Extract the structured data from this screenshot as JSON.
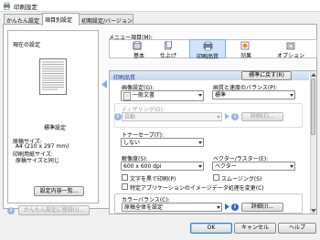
{
  "window": {
    "title": "印刷設定"
  },
  "tabs": [
    {
      "label": "かんたん設定"
    },
    {
      "label": "項目別設定"
    },
    {
      "label": "初期設定/バージョン"
    }
  ],
  "left": {
    "current_settings_label": "現在の設定",
    "preview_name": "標準設定",
    "paper_size_label": "原稿サイズ:",
    "paper_size_value": "A4 (210 x 297 mm)",
    "print_paper_label": "印刷用紙サイズ:",
    "print_paper_value": "原稿サイズと同じ",
    "settings_list_button": "設定内容一覧...",
    "register_button": "かんたん設定に登録(I)..."
  },
  "menu": {
    "label": "メニュー項目(M):",
    "items": [
      {
        "label": "基本"
      },
      {
        "label": "仕上げ"
      },
      {
        "label": "印刷品質"
      },
      {
        "label": "効果"
      },
      {
        "label": "オプション"
      }
    ]
  },
  "section": {
    "title": "印刷品質",
    "default_button": "標準に戻す(R)"
  },
  "image_settings": {
    "label": "画像設定(G):",
    "value": "一般文書"
  },
  "quality_speed": {
    "label": "画質と速度のバランス(P):",
    "value": "標準"
  },
  "dithering": {
    "label": "ディザリング(D):",
    "value": "自動",
    "detail_button": "詳細(E)..."
  },
  "toner_save": {
    "label": "トナーセーブ(T):",
    "value": "しない"
  },
  "resolution": {
    "label": "解像度(S):",
    "value": "600 x 600 dpi"
  },
  "vector_raster": {
    "label": "ベクター/ラスター(E):",
    "value": "ベクター"
  },
  "checkboxes": {
    "black_text": "文字を黒で印刷(P)",
    "smoothing": "スムージング(S)",
    "specific_app": "特定アプリケーションのイメージデータ処理を変更(C)"
  },
  "color_balance": {
    "label": "カラーバランス(C):",
    "value": "原稿全体を設定",
    "detail_button": "詳細(I)..."
  },
  "footer": {
    "ok": "OK",
    "cancel": "キャンセル",
    "help": "ヘルプ"
  }
}
